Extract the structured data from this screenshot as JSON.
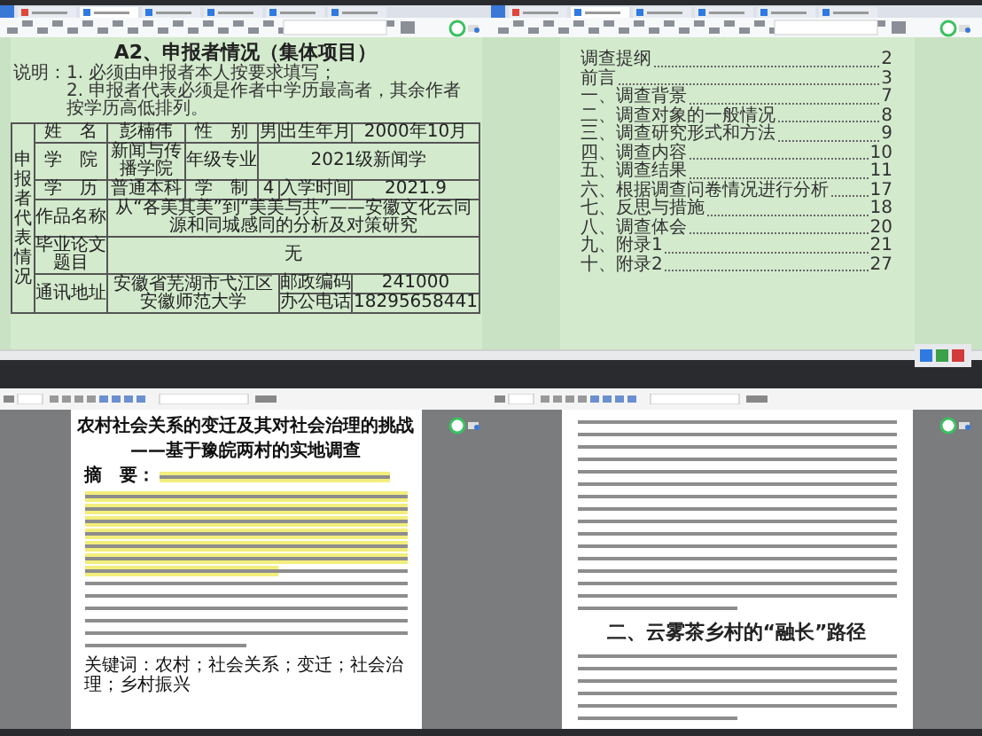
{
  "tiles": [
    {
      "kind": "form",
      "heading": "A2、申报者情况（集体项目）",
      "notes": [
        "说明：1. 必须由申报者本人按要求填写；",
        "2. 申报者代表必须是作者中学历最高者，其余作者按学历高低排列。"
      ],
      "side_label": "申报者代表情况",
      "rows": [
        {
          "kind": "triple",
          "cells": [
            "姓　名",
            "彭楠伟",
            "性　别",
            "男",
            "出生年月",
            "2000年10月"
          ]
        },
        {
          "kind": "double",
          "cells": [
            "学　院",
            "新闻与传播学院",
            "年级专业",
            {
              "text": "2021级新闻学",
              "colspan": 3
            }
          ]
        },
        {
          "kind": "triple",
          "cells": [
            "学　历",
            "普通本科",
            "学　制",
            "4",
            "入学时间",
            "2021.9"
          ]
        },
        {
          "kind": "wide",
          "cells": [
            "作品名称",
            {
              "text": "从“各美其美”到“美美与共”——安徽文化云同源和同城感同的分析及对策研究",
              "colspan": 5
            }
          ]
        },
        {
          "kind": "wide",
          "cells": [
            "毕业论文题目",
            {
              "text": "无",
              "colspan": 5
            }
          ]
        },
        {
          "kind": "contact",
          "cells": [
            "通讯地址",
            {
              "text": "安徽省芜湖市弋江区安徽师范大学",
              "colspan": 3
            },
            "邮政编码",
            "241000",
            "办公电话",
            "18295658441"
          ]
        }
      ]
    },
    {
      "kind": "toc",
      "entries": [
        {
          "label": "调查提纲",
          "page": "2"
        },
        {
          "label": "前言",
          "page": "3"
        },
        {
          "number": "一、",
          "label": "调查背景",
          "page": "7"
        },
        {
          "number": "二、",
          "label": "调查对象的一般情况",
          "page": "8"
        },
        {
          "number": "三、",
          "label": "调查研究形式和方法",
          "page": "9"
        },
        {
          "number": "四、",
          "label": "调查内容",
          "page": "10"
        },
        {
          "number": "五、",
          "label": "调查结果",
          "page": "11"
        },
        {
          "number": "六、",
          "label": "根据调查问卷情况进行分析",
          "page": "17"
        },
        {
          "number": "七、",
          "label": "反思与措施",
          "page": "18"
        },
        {
          "number": "八、",
          "label": "调查体会",
          "page": "20"
        },
        {
          "number": "九、",
          "label": "附录1",
          "page": "21"
        },
        {
          "number": "十、",
          "label": "附录2",
          "page": "27"
        }
      ]
    },
    {
      "kind": "article",
      "title": "农村社会关系的变迁及其对社会治理的挑战",
      "subtitle": "——基于豫皖两村的实地调查",
      "abstract": {
        "label": "摘　要：",
        "highlighted": true
      },
      "keywords": "关键词：农村；社会关系；变迁；社会治理；乡村振兴"
    },
    {
      "kind": "section",
      "heading": "二、云雾茶乡村的“融长”路径"
    }
  ]
}
